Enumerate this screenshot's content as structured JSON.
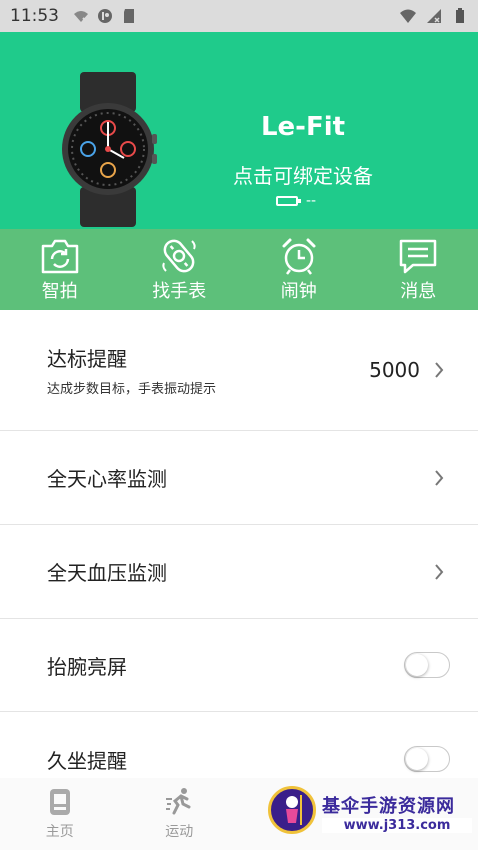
{
  "status_bar": {
    "time": "11:53",
    "left_icons": [
      "wifi-off-icon",
      "app-notification-icon",
      "sd-card-icon"
    ],
    "right_icons": [
      "wifi-icon",
      "cellular-signal-icon",
      "battery-icon"
    ]
  },
  "header": {
    "device_name": "Le-Fit",
    "bind_hint": "点击可绑定设备",
    "battery_text": "--",
    "background": "#1fcb8b"
  },
  "quick_actions": [
    {
      "label": "智拍",
      "icon": "camera-icon"
    },
    {
      "label": "找手表",
      "icon": "find-watch-icon"
    },
    {
      "label": "闹钟",
      "icon": "alarm-clock-icon"
    },
    {
      "label": "消息",
      "icon": "message-icon"
    }
  ],
  "settings": {
    "goal_reminder": {
      "title": "达标提醒",
      "subtitle": "达成步数目标，手表振动提示",
      "value": "5000"
    },
    "heart_rate": {
      "title": "全天心率监测"
    },
    "blood_pressure": {
      "title": "全天血压监测"
    },
    "wrist_raise": {
      "title": "抬腕亮屏",
      "enabled": false
    },
    "sedentary": {
      "title": "久坐提醒",
      "enabled": false
    }
  },
  "bottom_nav": [
    {
      "label": "主页",
      "icon": "home-icon"
    },
    {
      "label": "运动",
      "icon": "running-icon"
    }
  ],
  "watermark": {
    "title": "基伞手游资源网",
    "url": "www.j313.com"
  },
  "colors": {
    "header_green": "#1fcb8b",
    "quick_bar_green": "#5dc07a",
    "watermark_purple": "#3b2b9c"
  }
}
